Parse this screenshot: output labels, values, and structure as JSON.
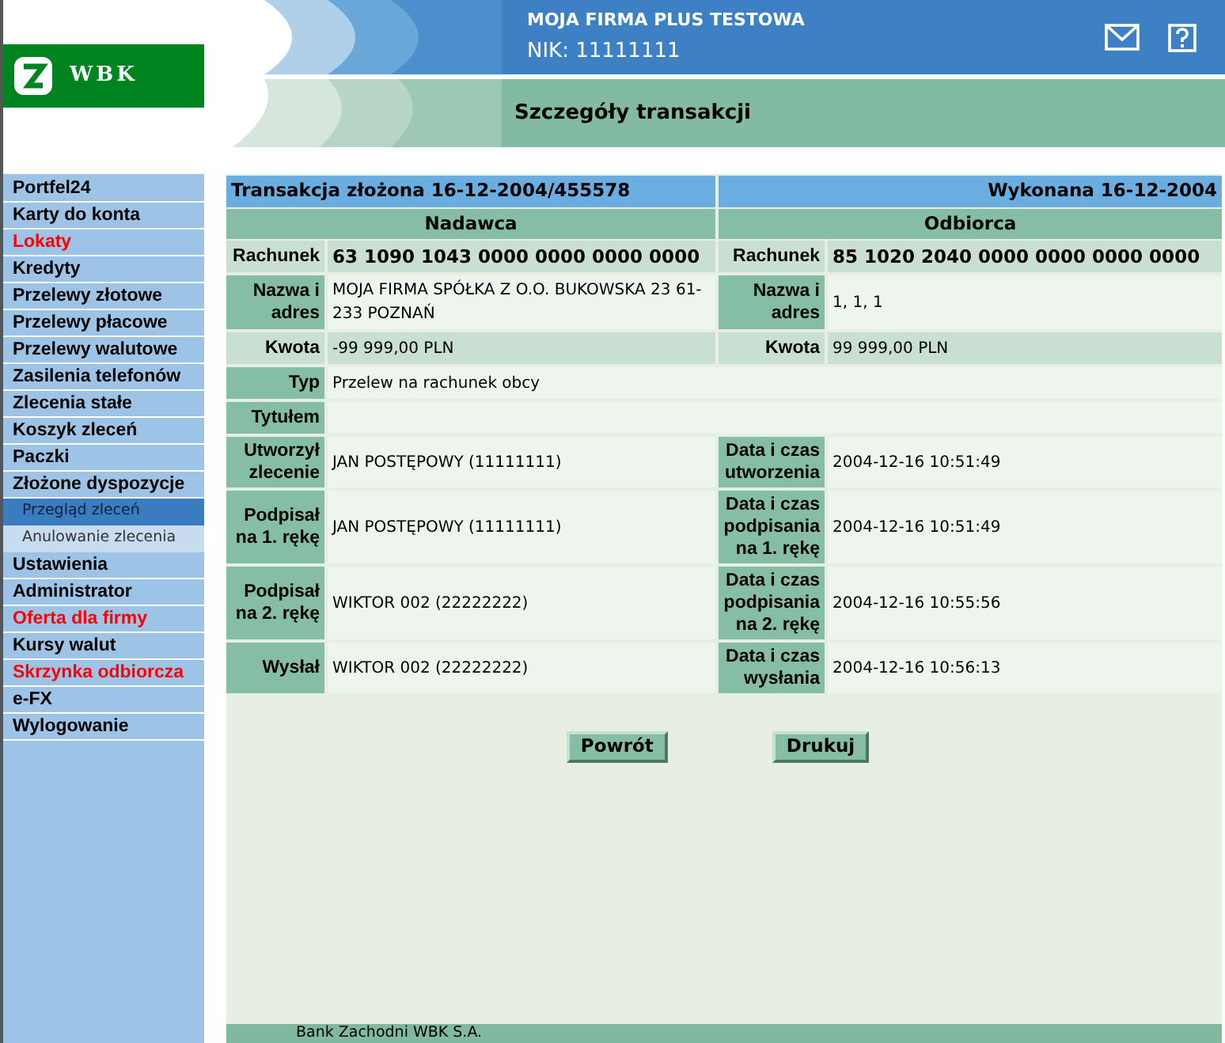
{
  "logo": {
    "text": "WBK"
  },
  "header": {
    "company": "MOJA FIRMA PLUS TESTOWA",
    "nik": "NIK: 11111111",
    "page_title": "Szczegóły transakcji"
  },
  "sidebar": {
    "items": [
      {
        "label": "Portfel24",
        "kind": "main",
        "highlighted": false
      },
      {
        "label": "Karty do konta",
        "kind": "main",
        "highlighted": false
      },
      {
        "label": "Lokaty",
        "kind": "main",
        "highlighted": true
      },
      {
        "label": "Kredyty",
        "kind": "main",
        "highlighted": false
      },
      {
        "label": "Przelewy złotowe",
        "kind": "main",
        "highlighted": false
      },
      {
        "label": "Przelewy płacowe",
        "kind": "main",
        "highlighted": false
      },
      {
        "label": "Przelewy walutowe",
        "kind": "main",
        "highlighted": false
      },
      {
        "label": "Zasilenia telefonów",
        "kind": "main",
        "highlighted": false
      },
      {
        "label": "Zlecenia stałe",
        "kind": "main",
        "highlighted": false
      },
      {
        "label": "Koszyk zleceń",
        "kind": "main",
        "highlighted": false
      },
      {
        "label": "Paczki",
        "kind": "main",
        "highlighted": false
      },
      {
        "label": "Złożone dyspozycje",
        "kind": "main",
        "highlighted": false
      },
      {
        "label": "Przegląd zleceń",
        "kind": "sub",
        "selected": true
      },
      {
        "label": "Anulowanie zlecenia",
        "kind": "sub",
        "selected": false
      },
      {
        "label": "Ustawienia",
        "kind": "main",
        "highlighted": false
      },
      {
        "label": "Administrator",
        "kind": "main",
        "highlighted": false
      },
      {
        "label": "Oferta dla firmy",
        "kind": "main",
        "highlighted": true
      },
      {
        "label": "Kursy walut",
        "kind": "main",
        "highlighted": false
      },
      {
        "label": "Skrzynka odbiorcza",
        "kind": "main",
        "highlighted": true
      },
      {
        "label": "e-FX",
        "kind": "main",
        "highlighted": false
      },
      {
        "label": "Wylogowanie",
        "kind": "main",
        "highlighted": false
      }
    ]
  },
  "transaction": {
    "title": "Transakcja złożona 16-12-2004/455578",
    "executed": "Wykonana 16-12-2004",
    "sender_heading": "Nadawca",
    "recipient_heading": "Odbiorca",
    "rows": [
      {
        "label": "Rachunek",
        "value": "63 1090 1043 0000 0000 0000 0000",
        "right_label": "Rachunek",
        "right_value": "85 1020 2040 0000 0000 0000 0000",
        "shaded": true,
        "bold": true
      },
      {
        "label": "Nazwa i adres",
        "value": "MOJA FIRMA SPÓŁKA Z O.O. BUKOWSKA  23  61-233 POZNAŃ",
        "right_label": "Nazwa i adres",
        "right_value": "1, 1, 1",
        "shaded": false,
        "bold": false
      },
      {
        "label": "Kwota",
        "value": "-99 999,00 PLN",
        "right_label": "Kwota",
        "right_value": "99 999,00 PLN",
        "shaded": true,
        "bold": false
      },
      {
        "label": "Typ",
        "value": "Przelew na rachunek obcy",
        "shaded": false,
        "bold": false
      },
      {
        "label": "Tytułem",
        "shaded": false
      },
      {
        "label": "Utworzył zlecenie",
        "value": "JAN POSTĘPOWY  (11111111)",
        "right_label": "Data i czas utworzenia",
        "right_value": "2004-12-16 10:51:49",
        "shaded": false,
        "bold": false
      },
      {
        "label": "Podpisał na 1. rękę",
        "value": "JAN POSTĘPOWY  (11111111)",
        "right_label": "Data i czas podpisania na 1. rękę",
        "right_value": "2004-12-16 10:51:49",
        "shaded": false,
        "bold": false
      },
      {
        "label": "Podpisał na 2. rękę",
        "value": "WIKTOR 002  (22222222)",
        "right_label": "Data i czas podpisania na 2. rękę",
        "right_value": "2004-12-16 10:55:56",
        "shaded": false,
        "bold": false
      },
      {
        "label": "Wysłał",
        "value": "WIKTOR 002  (22222222)",
        "right_label": "Data i czas wysłania",
        "right_value": "2004-12-16 10:56:13",
        "shaded": false,
        "bold": false
      }
    ]
  },
  "buttons": [
    "Powrót",
    "Drukuj"
  ],
  "footer": "Bank Zachodni WBK S.A."
}
